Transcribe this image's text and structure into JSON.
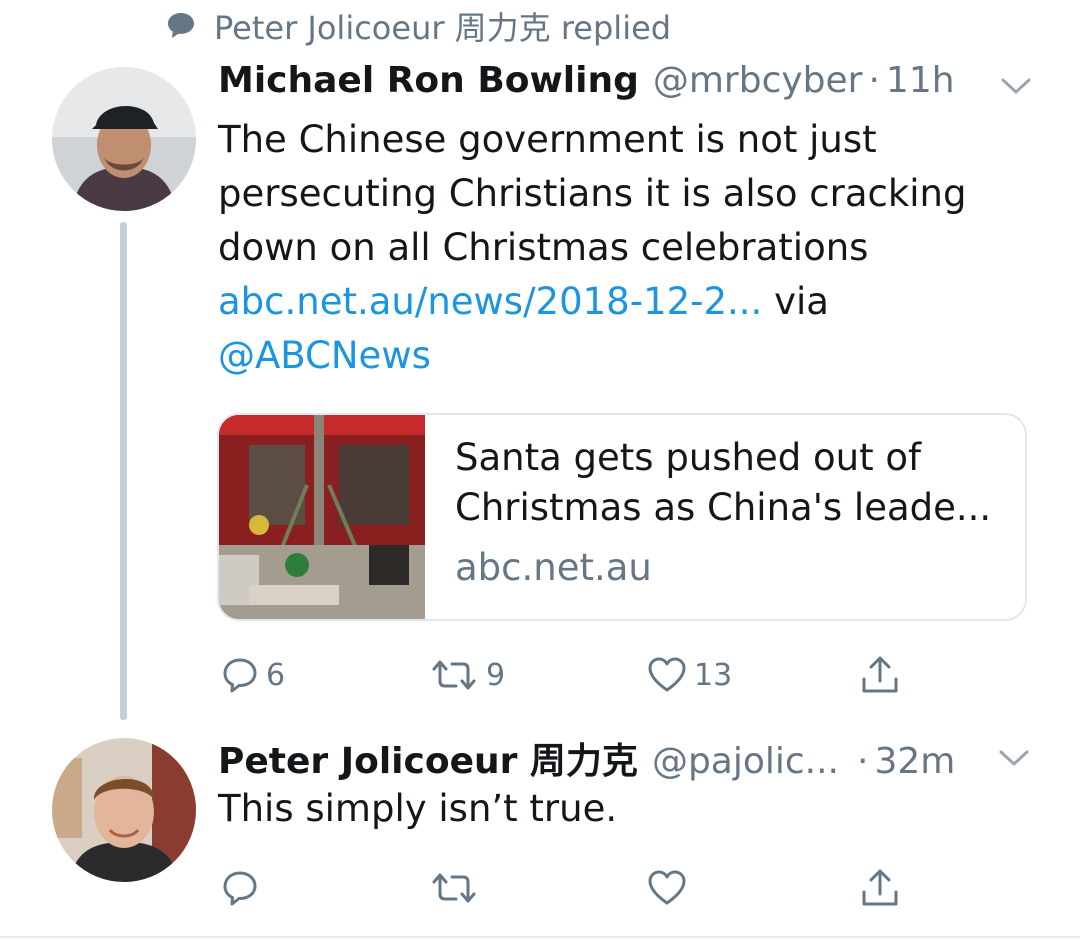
{
  "context": {
    "text": "Peter Jolicoeur 周力克 replied",
    "icon": "speech-bubble-icon"
  },
  "tweets": [
    {
      "name": "Michael Ron Bowling",
      "handle": "@mrbcyber",
      "separator": "·",
      "time": "11h",
      "text_lines": [
        "The Chinese government is not just",
        "persecuting Christians  it is also cracking",
        "down on all Christmas celebrations"
      ],
      "link": "abc.net.au/news/2018-12-2...",
      "via": "via",
      "mention": "@ABCNews",
      "card": {
        "title_line1": "Santa gets pushed out of",
        "title_line2": "Christmas as China's leade...",
        "domain": "abc.net.au"
      },
      "actions": {
        "replies": "6",
        "retweets": "9",
        "likes": "13"
      }
    },
    {
      "name": "Peter Jolicoeur 周力克",
      "handle": "@pajolic...",
      "separator": "·",
      "time": "32m",
      "text": "This simply isn’t true."
    }
  ],
  "colors": {
    "link": "#1b95e0",
    "muted": "#657786",
    "thread_line": "#c4cfd6",
    "border": "#e1e8ed"
  }
}
